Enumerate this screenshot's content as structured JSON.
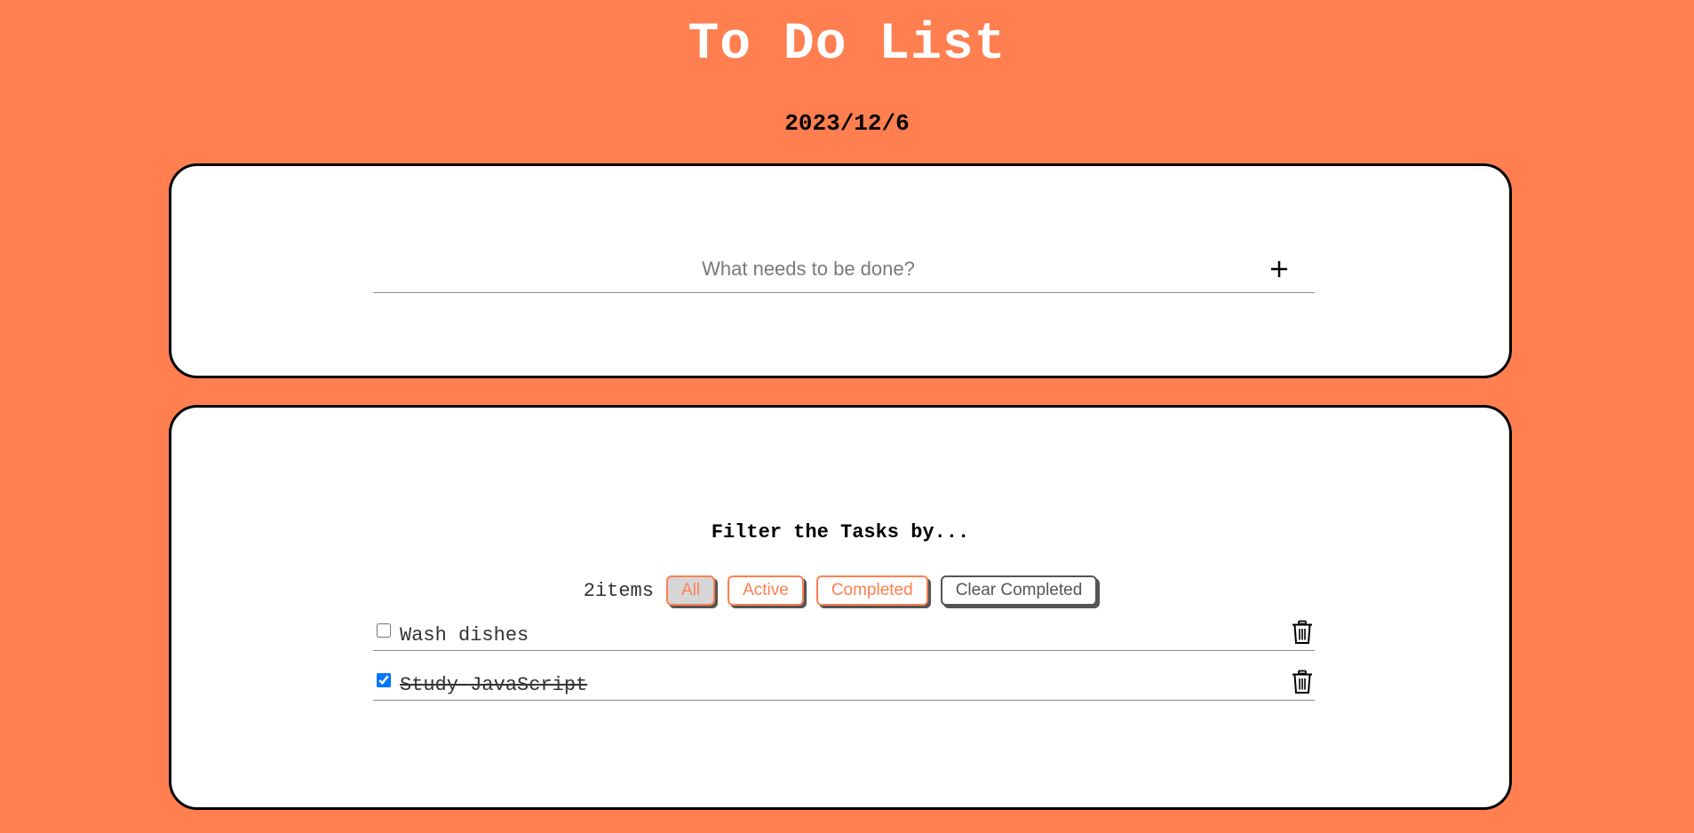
{
  "header": {
    "title": "To Do List",
    "date": "2023/12/6"
  },
  "add": {
    "placeholder": "What needs to be done?",
    "button_icon": "plus-icon"
  },
  "filter": {
    "title": "Filter the Tasks by...",
    "count": "2items",
    "buttons": {
      "all": "All",
      "active": "Active",
      "completed": "Completed",
      "clear": "Clear Completed"
    },
    "selected": "All"
  },
  "tasks": [
    {
      "text": "Wash dishes",
      "completed": false,
      "delete_icon": "trash-icon"
    },
    {
      "text": "Study JavaScript",
      "completed": true,
      "delete_icon": "trash-icon"
    }
  ],
  "colors": {
    "background": "#ff7f50",
    "card": "#ffffff",
    "accent": "#ff7f50",
    "selected_filter_bg": "#d6d6d6"
  }
}
